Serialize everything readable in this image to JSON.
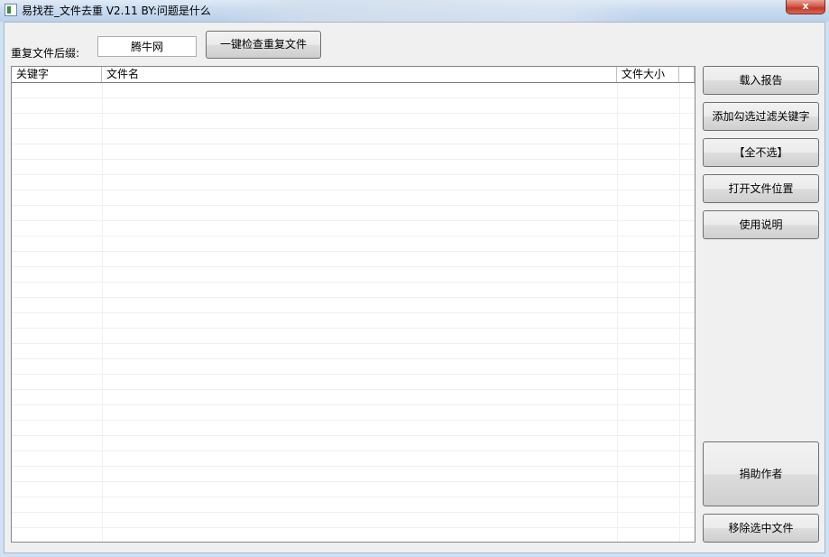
{
  "window": {
    "title": "易找茬_文件去重 V2.11  BY:问题是什么",
    "close_symbol": "x"
  },
  "suffix": {
    "label": "重复文件后缀:",
    "value": "腾牛网"
  },
  "buttons": {
    "check_duplicates": "一键检查重复文件",
    "load_report": "载入报告",
    "add_filter_keyword": "添加勾选过滤关键字",
    "deselect_all": "【全不选】",
    "open_file_location": "打开文件位置",
    "usage_help": "使用说明",
    "donate_author": "捐助作者",
    "remove_selected_files": "移除选中文件"
  },
  "table": {
    "columns": [
      "关键字",
      "文件名",
      "文件大小",
      ""
    ],
    "rows": []
  },
  "icons": {
    "app_icon": "app-window-icon",
    "close_icon": "close-icon"
  }
}
